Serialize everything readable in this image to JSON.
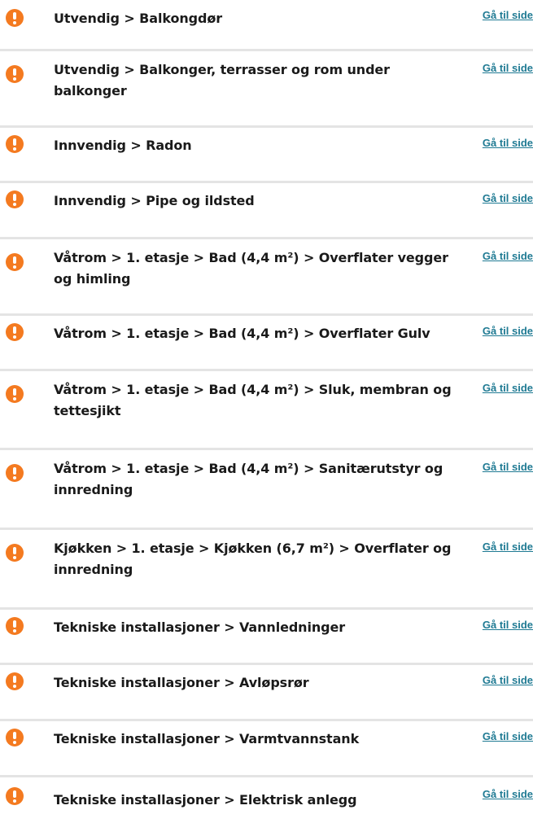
{
  "link_label": "Gå til side",
  "accent_colors": {
    "warning_icon": "#f47a20",
    "link": "#1f7a93",
    "divider": "#e4e4e4"
  },
  "items": [
    {
      "title": "Utvendig > Balkongdør",
      "icon": "exclamation-icon"
    },
    {
      "title": "Utvendig > Balkonger, terrasser og rom under balkonger",
      "icon": "exclamation-icon"
    },
    {
      "title": "Innvendig > Radon",
      "icon": "exclamation-icon"
    },
    {
      "title": "Innvendig > Pipe og ildsted",
      "icon": "exclamation-icon"
    },
    {
      "title": "Våtrom > 1. etasje > Bad (4,4 m²) > Overflater vegger og himling",
      "icon": "exclamation-icon"
    },
    {
      "title": "Våtrom > 1. etasje > Bad (4,4 m²) > Overflater Gulv",
      "icon": "exclamation-icon"
    },
    {
      "title": "Våtrom > 1. etasje > Bad (4,4 m²) > Sluk, membran og tettesjikt",
      "icon": "exclamation-icon"
    },
    {
      "title": "Våtrom > 1. etasje > Bad (4,4 m²) > Sanitærutstyr og innredning",
      "icon": "exclamation-icon"
    },
    {
      "title": "Kjøkken > 1. etasje > Kjøkken (6,7 m²) > Overflater og innredning",
      "icon": "exclamation-icon"
    },
    {
      "title": "Tekniske installasjoner > Vannledninger",
      "icon": "exclamation-icon"
    },
    {
      "title": "Tekniske installasjoner > Avløpsrør",
      "icon": "exclamation-icon"
    },
    {
      "title": "Tekniske installasjoner > Varmtvannstank",
      "icon": "exclamation-icon"
    },
    {
      "title": "Tekniske installasjoner > Elektrisk anlegg",
      "icon": "exclamation-icon"
    }
  ]
}
